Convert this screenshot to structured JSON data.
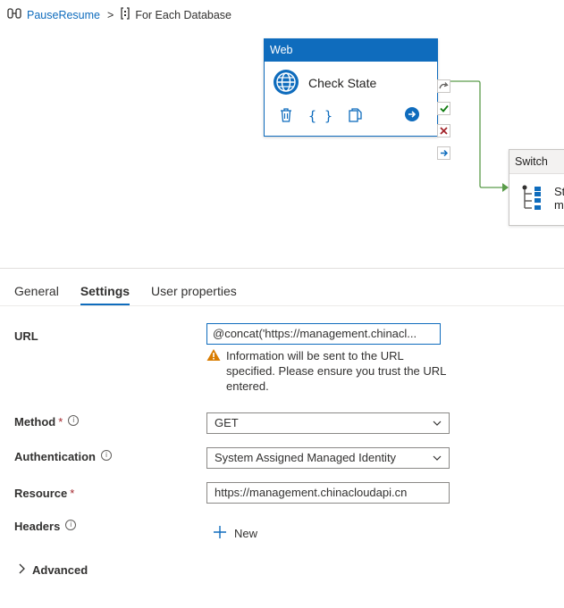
{
  "breadcrumb": {
    "pipeline": "PauseResume",
    "separator": ">",
    "activity": "For Each Database"
  },
  "canvas": {
    "web_activity": {
      "type": "Web",
      "name": "Check State"
    },
    "switch_activity": {
      "type": "Switch",
      "line1": "St",
      "line2": "m"
    }
  },
  "tabs": [
    {
      "label": "General",
      "active": false
    },
    {
      "label": "Settings",
      "active": true
    },
    {
      "label": "User properties",
      "active": false
    }
  ],
  "form": {
    "url": {
      "label": "URL",
      "value": "@concat('https://management.chinacl...",
      "warning": "Information will be sent to the URL specified. Please ensure you trust the URL entered."
    },
    "method": {
      "label": "Method",
      "required": "*",
      "value": "GET"
    },
    "authentication": {
      "label": "Authentication",
      "value": "System Assigned Managed Identity"
    },
    "resource": {
      "label": "Resource",
      "required": "*",
      "value": "https://management.chinacloudapi.cn"
    },
    "headers": {
      "label": "Headers",
      "new_label": "New"
    },
    "advanced": {
      "label": "Advanced"
    }
  },
  "colors": {
    "accent": "#0f6cbd",
    "success": "#107c10",
    "error": "#a4262c",
    "warning": "#d97c00",
    "connector": "#5a9c4a"
  },
  "icons": [
    "pipeline-icon",
    "foreach-icon",
    "globe-icon",
    "delete-icon",
    "code-icon",
    "copy-icon",
    "go-arrow-icon",
    "skip-icon",
    "success-icon",
    "failure-icon",
    "completion-icon",
    "switch-icon",
    "info-icon",
    "warning-icon",
    "chevron-down-icon",
    "plus-icon",
    "chevron-right-icon"
  ]
}
